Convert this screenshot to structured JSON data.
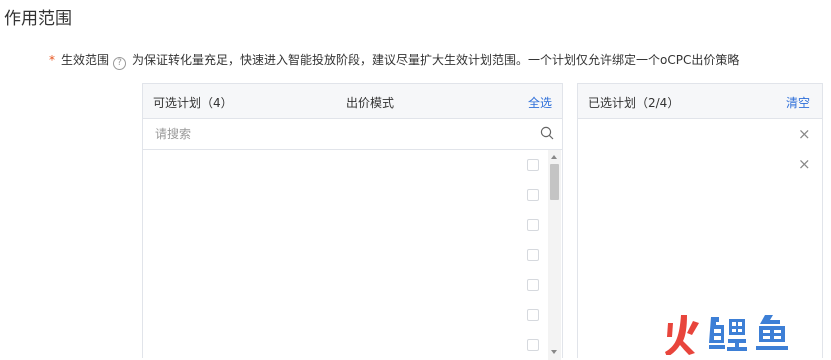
{
  "section_title": "作用范围",
  "field": {
    "required_mark": "*",
    "label": "生效范围",
    "help_icon": "question-circle-icon",
    "help_glyph": "?",
    "description": "为保证转化量充足，快速进入智能投放阶段，建议尽量扩大生效计划范围。一个计划仅允许绑定一个oCPC出价策略"
  },
  "left_panel": {
    "title": "可选计划（4）",
    "column_bid": "出价模式",
    "select_all": "全选",
    "search_placeholder": "请搜索",
    "search_icon": "search-icon",
    "rows": 7
  },
  "right_panel": {
    "title": "已选计划（2/4）",
    "clear": "清空",
    "remove_glyph": "×",
    "selected_count": 2
  },
  "colors": {
    "link": "#2e6fd9",
    "required": "#e8541e",
    "border": "#e1e4ea",
    "header_bg": "#f6f7f9",
    "watermark_red": "#e8453c",
    "watermark_blue": "#3d7fd6"
  },
  "watermark": {
    "text": "火鲤鱼"
  }
}
